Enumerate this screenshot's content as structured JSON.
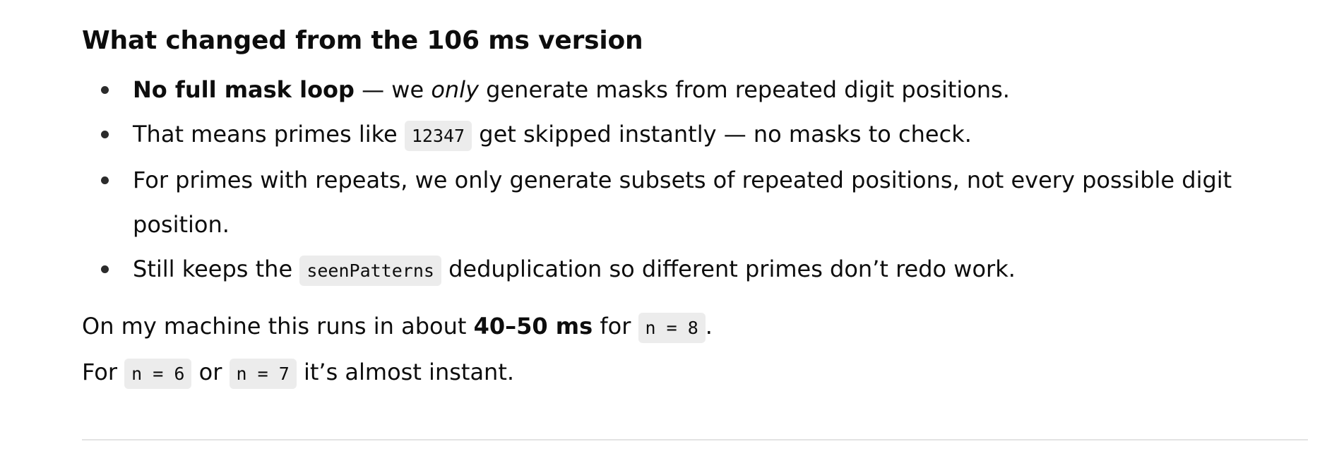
{
  "heading": "What changed from the 106 ms version",
  "bullets": [
    {
      "bold": "No full mask loop",
      "after_bold": " — we ",
      "em": "only",
      "rest": " generate masks from repeated digit positions."
    },
    {
      "before": "That means primes like ",
      "code": "12347",
      "after": " get skipped instantly — no masks to check."
    },
    {
      "text": "For primes with repeats, we only generate subsets of repeated positions, not every possible digit position."
    },
    {
      "before": "Still keeps the ",
      "code": "seenPatterns",
      "after": " deduplication so different primes don’t redo work."
    }
  ],
  "para1": {
    "before": "On my machine this runs in about ",
    "bold": "40–50 ms",
    "mid": " for ",
    "code": "n = 8",
    "after": "."
  },
  "para2": {
    "before": "For ",
    "code1": "n = 6",
    "mid": " or ",
    "code2": "n = 7",
    "after": " it’s almost instant."
  }
}
